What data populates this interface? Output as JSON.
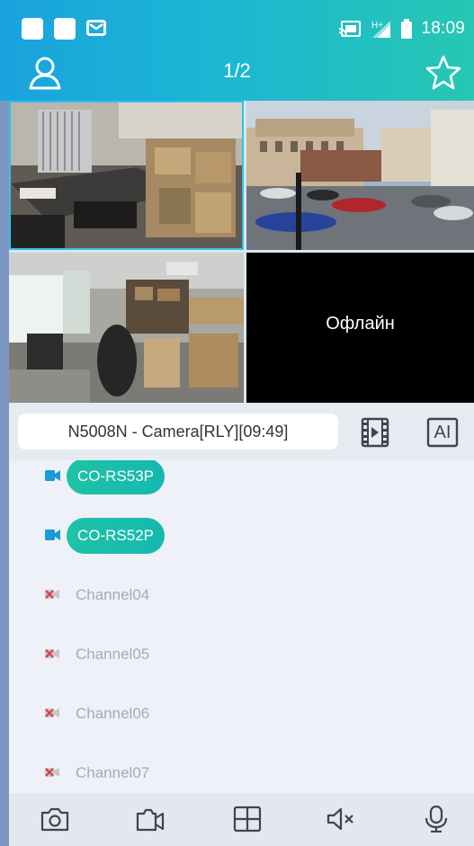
{
  "status_bar": {
    "time": "18:09",
    "icons": [
      "app-square-icon",
      "app-square-icon",
      "mail-icon",
      "cast-icon",
      "signal-h-plus-icon",
      "battery-icon"
    ]
  },
  "top_bar": {
    "page_indicator": "1/2",
    "left_icon": "user-icon",
    "right_icon": "star-icon"
  },
  "grid": {
    "offline_label": "Офлайн"
  },
  "controls": {
    "camera_label": "N5008N - Camera[RLY][09:49]",
    "playback_icon": "film-icon",
    "ai_label": "AI"
  },
  "channels": [
    {
      "label": "CO-RS53P",
      "online": true
    },
    {
      "label": "CO-RS52P",
      "online": true
    },
    {
      "label": "Channel04",
      "online": false
    },
    {
      "label": "Channel05",
      "online": false
    },
    {
      "label": "Channel06",
      "online": false
    },
    {
      "label": "Channel07",
      "online": false
    }
  ],
  "toolbar": {
    "icons": [
      "snapshot-camera-icon",
      "record-video-icon",
      "layout-grid-icon",
      "mute-speaker-icon",
      "microphone-icon"
    ]
  },
  "colors": {
    "header_start": "#1aa3dd",
    "header_end": "#27c7b3",
    "active_tile_border": "#33c0e8",
    "online_pill": "#1ec3a5",
    "offline_text": "#a6acb3"
  }
}
